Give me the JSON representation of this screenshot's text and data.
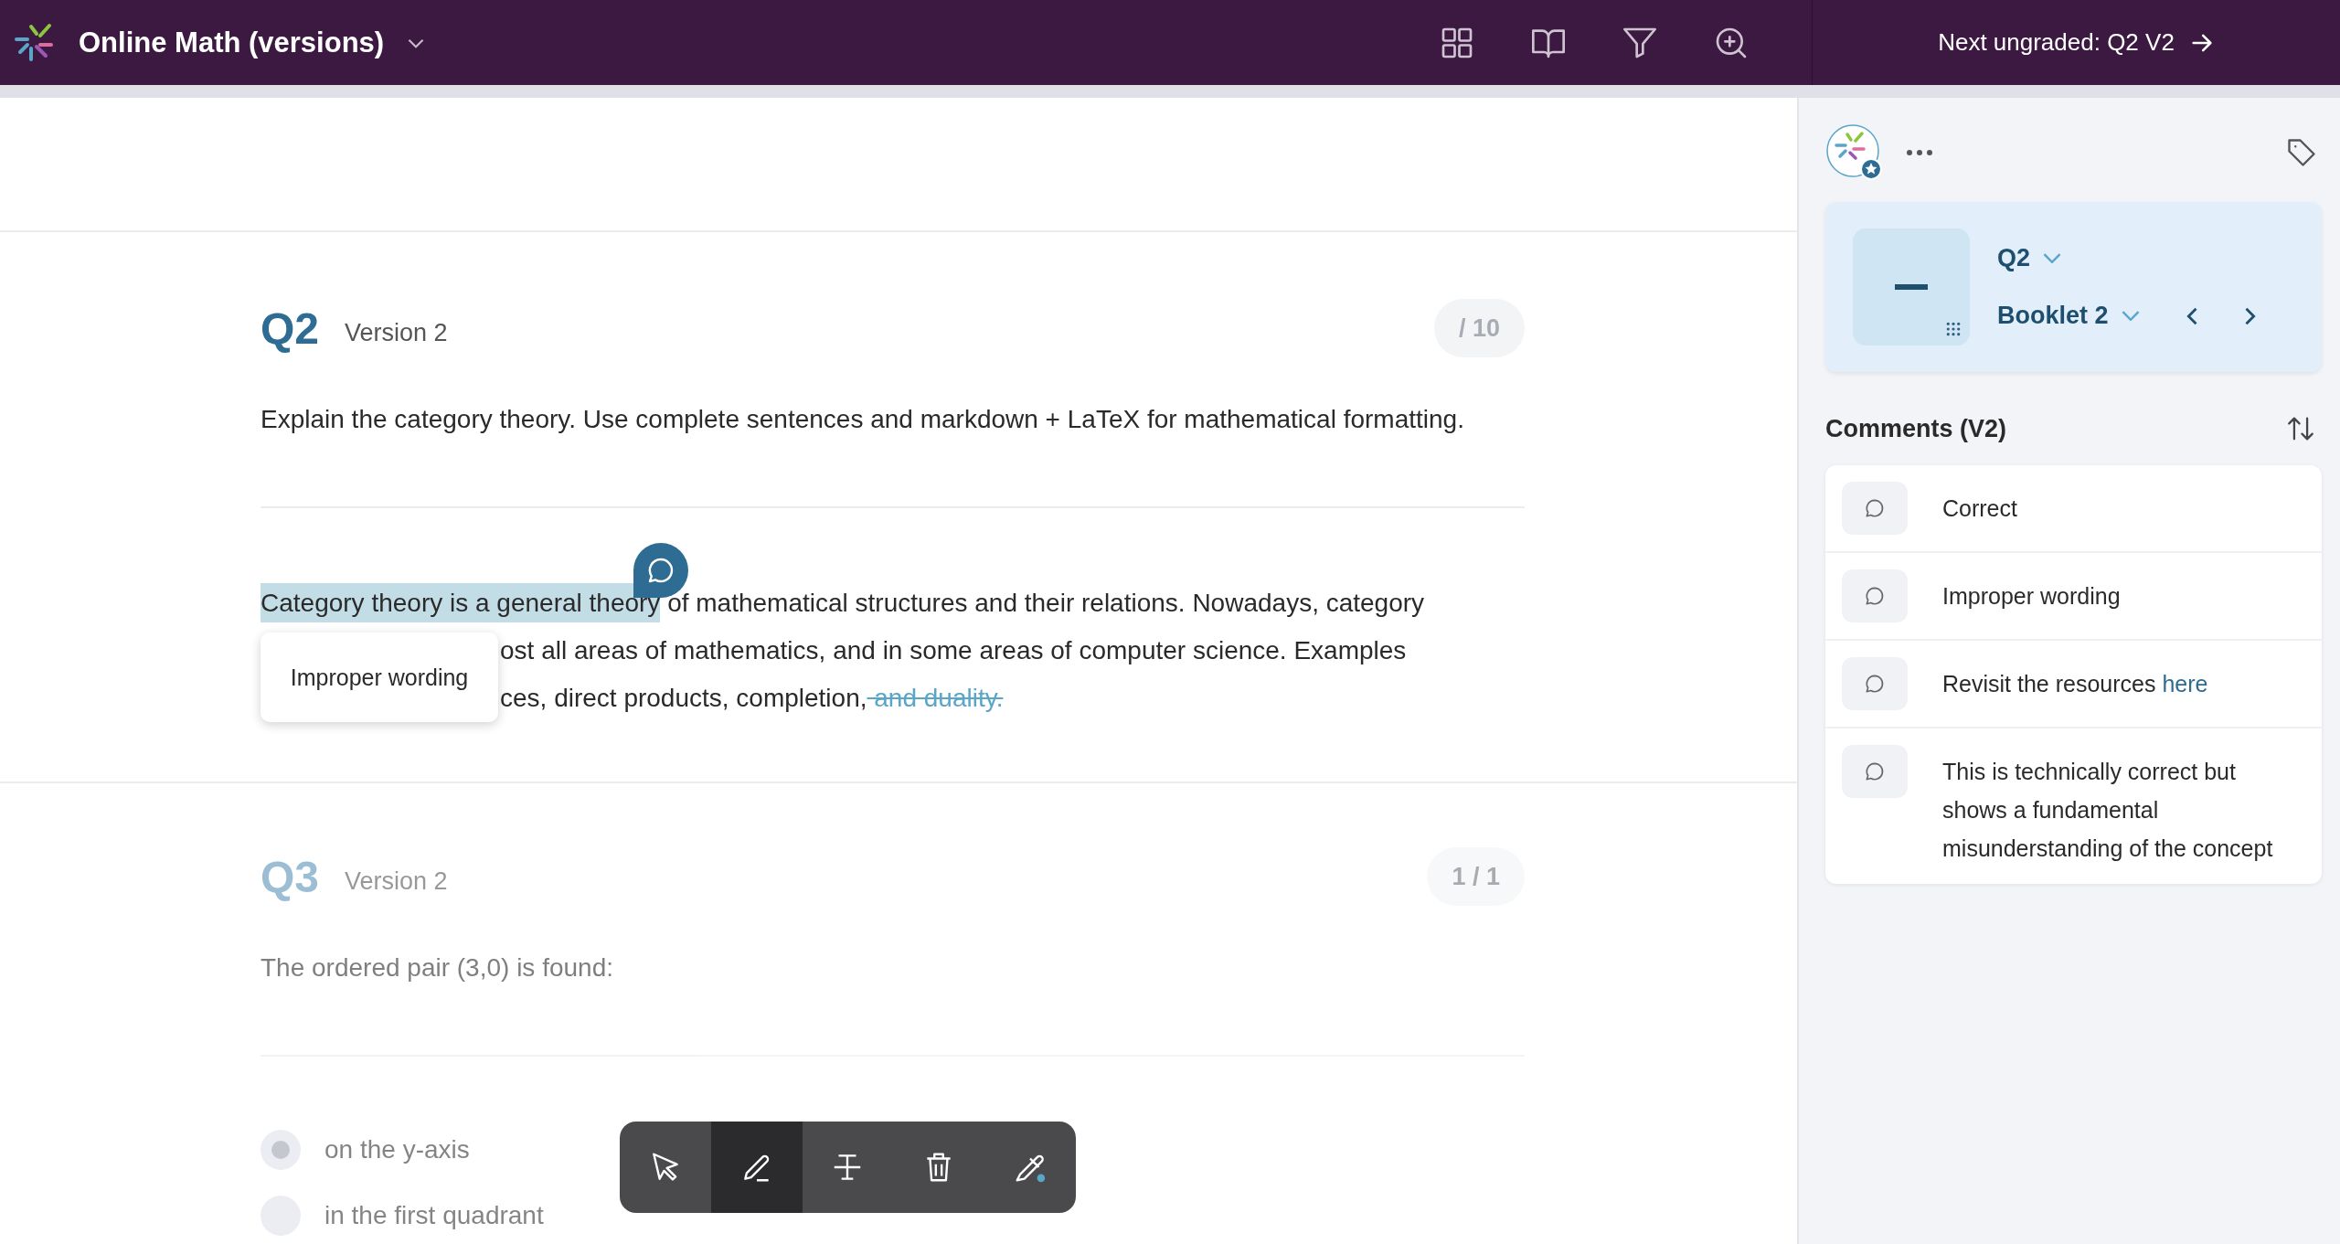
{
  "app_bar": {
    "title": "Online Math (versions)",
    "next_button": "Next ungraded: Q2 V2"
  },
  "questions": [
    {
      "kind": "essay",
      "number": "Q2",
      "version": "Version 2",
      "score": "/ 10",
      "faded": false,
      "prompt": "Explain the category theory. Use complete sentences and markdown + LaTeX for mathematical formatting.",
      "comment_popup": "Improper wording",
      "answer_lines": [
        {
          "starts_under_popup": false,
          "segments": [
            {
              "kind": "highlight",
              "text": "Category theory is a general theory"
            },
            {
              "kind": "plain",
              "text": " of mathematical structures and their relations. Nowadays, category"
            }
          ]
        },
        {
          "starts_under_popup": true,
          "segments": [
            {
              "kind": "plain",
              "text": "ost all areas of mathematics, and in some areas of computer science. Examples"
            }
          ]
        },
        {
          "starts_under_popup": true,
          "segments": [
            {
              "kind": "plain",
              "text": "ces, direct products, completion,"
            },
            {
              "kind": "strike",
              "text": " and duality."
            }
          ]
        }
      ]
    },
    {
      "kind": "choice",
      "number": "Q3",
      "version": "Version 2",
      "score": "1 / 1",
      "faded": true,
      "prompt": "The ordered pair (3,0) is found:",
      "options": [
        {
          "label": "on the y-axis",
          "selected": true
        },
        {
          "label": "in the first quadrant",
          "selected": false
        }
      ]
    }
  ],
  "toolbar": [
    {
      "kind": "select",
      "selected": false
    },
    {
      "kind": "pen",
      "selected": true
    },
    {
      "kind": "strike",
      "selected": false
    },
    {
      "kind": "delete",
      "selected": false
    },
    {
      "kind": "color",
      "selected": false
    }
  ],
  "panel": {
    "question": "Q2",
    "booklet": "Booklet 2",
    "comments_title": "Comments (V2)",
    "comments": [
      {
        "text": "Correct"
      },
      {
        "text": "Improper wording"
      },
      {
        "text": "Revisit the resources",
        "link": "here"
      },
      {
        "text": "This is technically correct but shows a fundamental misunderstanding of the concept"
      }
    ]
  }
}
